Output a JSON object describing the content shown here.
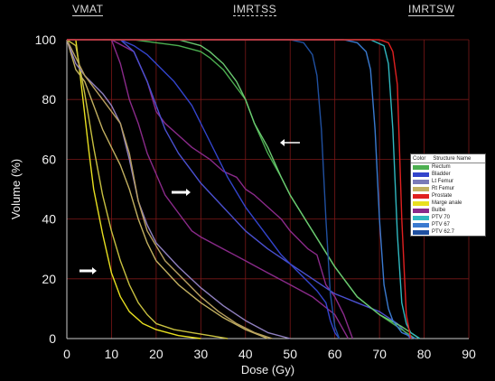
{
  "headers": {
    "left": "VMAT",
    "middle": "IMRTSS",
    "right": "IMRTSW"
  },
  "legend": {
    "color_header": "Color",
    "name_header": "Structure Name",
    "items": [
      {
        "name": "Rectum",
        "color": "#4caf50"
      },
      {
        "name": "Bladder",
        "color": "#3344cc"
      },
      {
        "name": "Lt Femur",
        "color": "#7a7ab8"
      },
      {
        "name": "Rt Femur",
        "color": "#c2b060"
      },
      {
        "name": "Prostate",
        "color": "#e02020"
      },
      {
        "name": "Marge anale",
        "color": "#e8e020"
      },
      {
        "name": "Bulbe",
        "color": "#8a2a8a"
      },
      {
        "name": "PTV 70",
        "color": "#30b8c0"
      },
      {
        "name": "PTV 67",
        "color": "#3a7ad0"
      },
      {
        "name": "PTV 62.7",
        "color": "#2050a0"
      }
    ]
  },
  "chart_data": {
    "type": "line",
    "title": "",
    "xlabel": "Dose (Gy)",
    "ylabel": "Volume (%)",
    "xlim": [
      0,
      90
    ],
    "ylim": [
      0,
      100
    ],
    "xticks": [
      0,
      10,
      20,
      30,
      40,
      50,
      60,
      70,
      80,
      90
    ],
    "yticks": [
      0,
      20,
      40,
      60,
      80,
      100
    ],
    "grid": true,
    "legend_position": "right",
    "series": [
      {
        "name": "Marge anale",
        "color": "#e8e020",
        "x": [
          0,
          2,
          3,
          4,
          5,
          6,
          8,
          10,
          12,
          14,
          17,
          20,
          25,
          30
        ],
        "y": [
          100,
          100,
          88,
          75,
          62,
          50,
          35,
          22,
          14,
          9,
          5,
          3,
          1,
          0
        ]
      },
      {
        "name": "Marge anale",
        "color": "#c8c040",
        "x": [
          0,
          2,
          4,
          6,
          8,
          10,
          12,
          14,
          16,
          18,
          20,
          24,
          28,
          32,
          36
        ],
        "y": [
          100,
          98,
          82,
          64,
          48,
          36,
          26,
          18,
          12,
          8,
          5,
          3,
          2,
          1,
          0
        ]
      },
      {
        "name": "Rt Femur",
        "color": "#c2b060",
        "x": [
          0,
          2,
          4,
          6,
          8,
          10,
          12,
          14,
          16,
          18,
          20,
          25,
          30,
          35,
          40,
          45
        ],
        "y": [
          100,
          90,
          86,
          78,
          70,
          64,
          58,
          50,
          40,
          32,
          26,
          18,
          12,
          7,
          3,
          0
        ]
      },
      {
        "name": "Lt Femur",
        "color": "#9080c0",
        "x": [
          0,
          2,
          4,
          6,
          8,
          10,
          12,
          14,
          16,
          18,
          20,
          25,
          30,
          35,
          40,
          45,
          50
        ],
        "y": [
          100,
          92,
          88,
          85,
          82,
          78,
          72,
          60,
          46,
          38,
          32,
          24,
          17,
          11,
          6,
          2,
          0
        ]
      },
      {
        "name": "Rt Femur",
        "color": "#b8a060",
        "x": [
          0,
          4,
          8,
          12,
          14,
          16,
          18,
          22,
          26,
          30,
          34,
          38,
          42,
          46
        ],
        "y": [
          100,
          88,
          80,
          72,
          62,
          46,
          36,
          26,
          20,
          14,
          9,
          5,
          2,
          0
        ]
      },
      {
        "name": "Bulbe",
        "color": "#8a2a8a",
        "x": [
          8,
          10,
          12,
          14,
          16,
          18,
          20,
          22,
          25,
          28,
          30,
          35,
          40,
          45,
          50,
          55,
          60,
          63
        ],
        "y": [
          100,
          100,
          92,
          80,
          72,
          62,
          55,
          48,
          42,
          36,
          34,
          30,
          26,
          22,
          18,
          14,
          8,
          0
        ]
      },
      {
        "name": "Bulbe",
        "color": "#8a2a8a",
        "x": [
          10,
          15,
          18,
          20,
          22,
          25,
          28,
          30,
          32,
          35,
          38,
          40,
          42,
          45,
          48,
          50,
          54,
          56,
          58,
          60,
          62,
          64
        ],
        "y": [
          100,
          96,
          86,
          76,
          72,
          68,
          64,
          62,
          60,
          56,
          54,
          50,
          48,
          44,
          40,
          36,
          30,
          28,
          18,
          14,
          8,
          0
        ]
      },
      {
        "name": "Bladder",
        "color": "#4a50d0",
        "x": [
          12,
          15,
          18,
          20,
          22,
          25,
          28,
          30,
          35,
          40,
          45,
          50,
          55,
          60,
          65,
          70,
          74,
          77
        ],
        "y": [
          100,
          96,
          86,
          78,
          70,
          62,
          56,
          52,
          44,
          36,
          30,
          25,
          20,
          15,
          12,
          9,
          5,
          0
        ]
      },
      {
        "name": "Bladder",
        "color": "#3344cc",
        "x": [
          12,
          15,
          18,
          20,
          24,
          28,
          32,
          36,
          40,
          44,
          48,
          52,
          56,
          58,
          59,
          60,
          61
        ],
        "y": [
          100,
          98,
          95,
          92,
          86,
          78,
          66,
          54,
          44,
          36,
          28,
          22,
          16,
          12,
          6,
          2,
          0
        ]
      },
      {
        "name": "Rectum",
        "color": "#4caf50",
        "x": [
          15,
          20,
          25,
          30,
          32,
          35,
          38,
          40,
          42,
          45,
          48,
          50,
          55,
          60,
          65,
          70,
          75,
          78
        ],
        "y": [
          100,
          99,
          98,
          96,
          94,
          90,
          84,
          80,
          72,
          62,
          54,
          48,
          36,
          24,
          14,
          8,
          3,
          0
        ]
      },
      {
        "name": "Rectum",
        "color": "#6ac870",
        "x": [
          20,
          25,
          30,
          32,
          35,
          38,
          40,
          42,
          45,
          48,
          50,
          55,
          60,
          65,
          70,
          75,
          79
        ],
        "y": [
          100,
          100,
          98,
          96,
          92,
          86,
          80,
          72,
          64,
          54,
          48,
          36,
          24,
          14,
          8,
          4,
          0
        ]
      },
      {
        "name": "PTV 62.7",
        "color": "#2050a0",
        "x": [
          0,
          50,
          53,
          55,
          56,
          57,
          58,
          59,
          60,
          61
        ],
        "y": [
          100,
          100,
          99,
          95,
          88,
          70,
          40,
          15,
          4,
          0
        ]
      },
      {
        "name": "PTV 67",
        "color": "#3a7ad0",
        "x": [
          0,
          62,
          65,
          67,
          68,
          69,
          70,
          71,
          72,
          73,
          75,
          78
        ],
        "y": [
          100,
          100,
          99,
          96,
          90,
          70,
          40,
          18,
          10,
          6,
          2,
          0
        ]
      },
      {
        "name": "PTV 70",
        "color": "#30b8c0",
        "x": [
          0,
          68,
          71,
          72,
          73,
          74,
          75,
          76,
          77,
          78,
          79
        ],
        "y": [
          100,
          100,
          98,
          92,
          70,
          35,
          12,
          5,
          2,
          1,
          0
        ]
      },
      {
        "name": "Prostate",
        "color": "#e02020",
        "x": [
          0,
          70,
          72,
          73,
          74,
          75,
          76,
          77
        ],
        "y": [
          100,
          100,
          99,
          96,
          85,
          40,
          8,
          0
        ]
      }
    ]
  }
}
